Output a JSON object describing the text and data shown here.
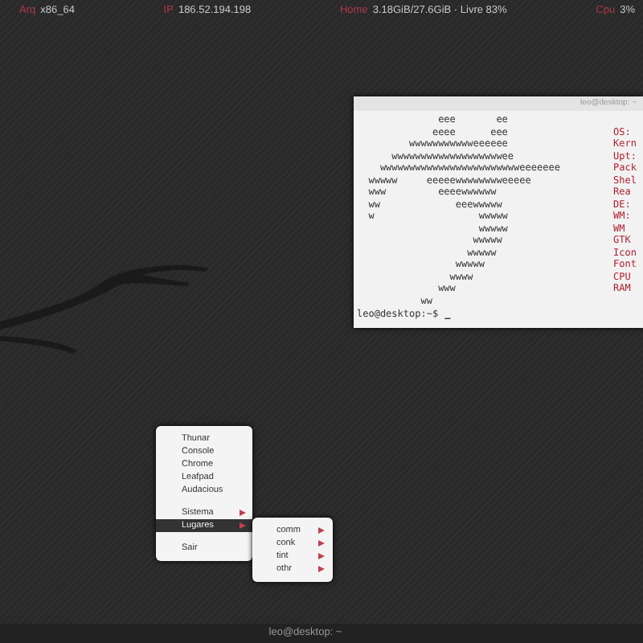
{
  "top_bar": [
    {
      "label": "Arq",
      "value": "x86_64"
    },
    {
      "label": "IP",
      "value": "186.52.194.198"
    },
    {
      "label": "Home",
      "value": "3.18GiB/27.6GiB · Livre 83%"
    },
    {
      "label": "Cpu",
      "value": "3%"
    }
  ],
  "terminal": {
    "title": "leo@desktop: ~",
    "art_lines": [
      "              eee       ee",
      "             eeee      eee",
      "         wwwwwwwwwwweeeeee",
      "      wwwwwwwwwwwwwwwwwwwee",
      "    wwwwwwwwwwwwwwwwwwwwwwwweeeeeee",
      "  wwwww     eeeeewwwwwwwweeeee",
      "  www         eeeewwwwww",
      "  ww             eeewwwww",
      "  w                  wwwww",
      "                     wwwww",
      "                    wwwww",
      "                   wwwww",
      "                 wwwww",
      "                wwww",
      "              www",
      "           ww"
    ],
    "info_labels": [
      "OS:",
      "Kern",
      "Upt:",
      "Pack",
      "Shel",
      "Rea",
      "DE:",
      "WM:",
      "WM",
      "GTK",
      "Icon",
      "Font",
      "CPU",
      "RAM"
    ],
    "prompt": "leo@desktop:~$",
    "cursor": "_"
  },
  "menu": {
    "groups": [
      [
        {
          "label": "Thunar",
          "kind": "item",
          "selected": false
        },
        {
          "label": "Console",
          "kind": "item",
          "selected": false
        },
        {
          "label": "Chrome",
          "kind": "item",
          "selected": false
        },
        {
          "label": "Leafpad",
          "kind": "item",
          "selected": false
        },
        {
          "label": "Audacious",
          "kind": "item",
          "selected": false
        }
      ],
      [
        {
          "label": "Sistema",
          "kind": "submenu",
          "selected": false
        },
        {
          "label": "Lugares",
          "kind": "submenu",
          "selected": true
        }
      ],
      [
        {
          "label": "Sair",
          "kind": "item",
          "selected": false
        }
      ]
    ],
    "submenu": [
      {
        "label": "comm",
        "kind": "submenu"
      },
      {
        "label": "conk",
        "kind": "submenu"
      },
      {
        "label": "tint",
        "kind": "submenu"
      },
      {
        "label": "othr",
        "kind": "submenu"
      }
    ]
  },
  "bottom_bar": {
    "title": "leo@desktop: ~"
  }
}
